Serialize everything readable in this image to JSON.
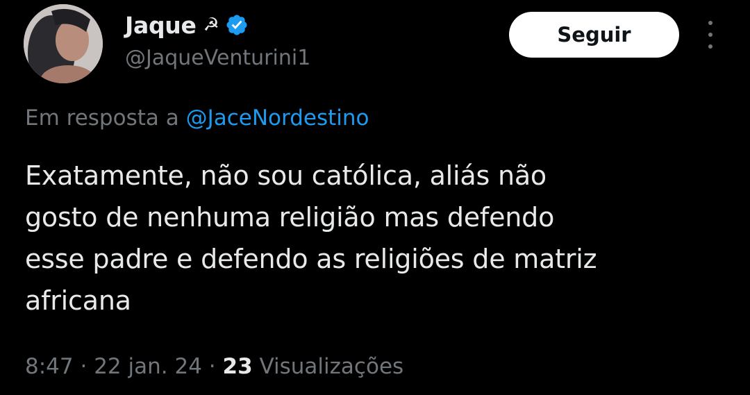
{
  "author": {
    "display_name": "Jaque",
    "badge_emoji": "☭",
    "verified_icon": "verified-badge-icon",
    "handle": "@JaqueVenturini1"
  },
  "actions": {
    "follow_label": "Seguir",
    "more_icon": "more-vertical-icon"
  },
  "reply": {
    "prefix": "Em resposta a",
    "target_handle": "@JaceNordestino"
  },
  "tweet": {
    "text_lines": [
      "Exatamente, não sou católica, aliás não",
      "gosto de nenhuma religião mas defendo",
      "esse padre e defendo as religiões de matriz",
      "africana"
    ]
  },
  "meta": {
    "time": "8:47",
    "separator": "·",
    "date": "22 jan. 24",
    "views_count": "23",
    "views_label": "Visualizações"
  },
  "colors": {
    "background": "#000000",
    "text_primary": "#e7e9ea",
    "text_secondary": "#71767b",
    "link": "#1d9bf0",
    "verified": "#1d9bf0",
    "follow_bg": "#ffffff"
  }
}
